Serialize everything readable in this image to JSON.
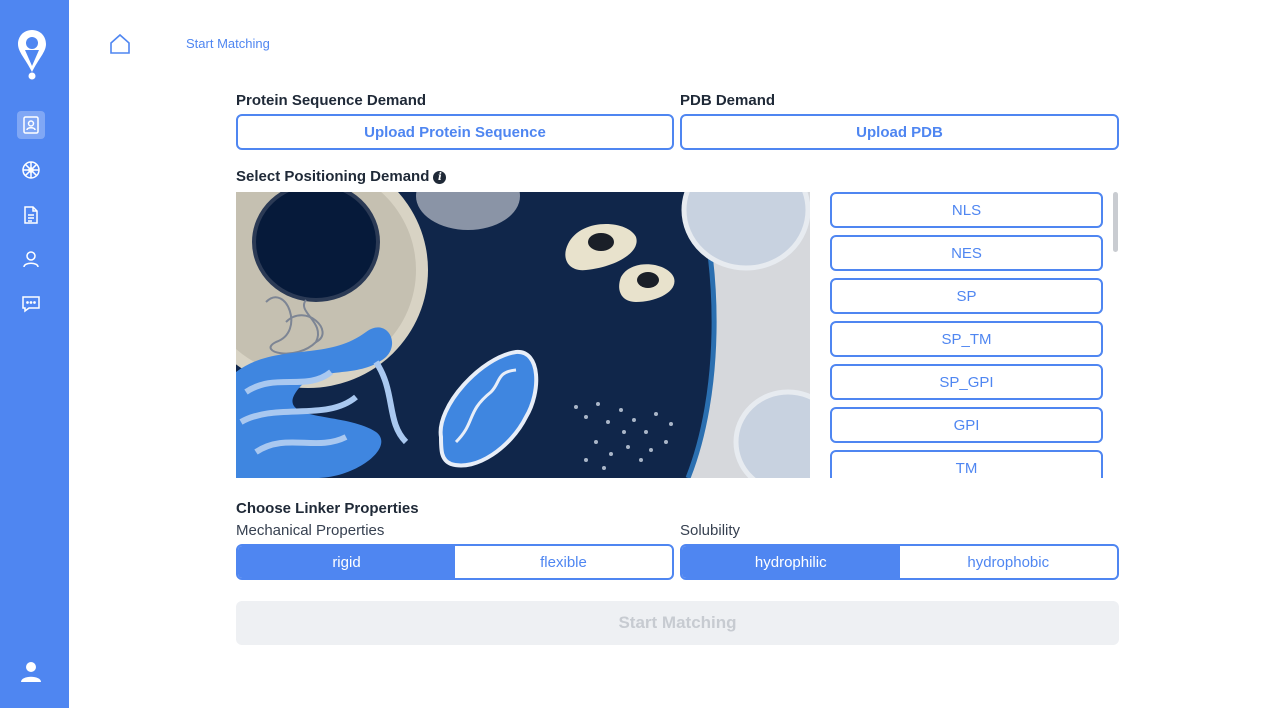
{
  "topbar": {
    "link": "Start Matching"
  },
  "sidebar": {
    "items": [
      {
        "icon": "contact-card-icon",
        "active": true
      },
      {
        "icon": "wheel-icon",
        "active": false
      },
      {
        "icon": "document-icon",
        "active": false
      },
      {
        "icon": "user-icon",
        "active": false
      },
      {
        "icon": "chat-icon",
        "active": false
      }
    ],
    "bottom_icon": "account-icon"
  },
  "protein": {
    "label": "Protein Sequence Demand",
    "button": "Upload Protein Sequence"
  },
  "pdb": {
    "label": "PDB Demand",
    "button": "Upload PDB"
  },
  "positioning": {
    "label": "Select Positioning Demand",
    "options": [
      "NLS",
      "NES",
      "SP",
      "SP_TM",
      "SP_GPI",
      "GPI",
      "TM"
    ]
  },
  "linker": {
    "label": "Choose Linker Properties",
    "mechanical": {
      "label": "Mechanical Properties",
      "options": [
        "rigid",
        "flexible"
      ],
      "selected": "rigid"
    },
    "solubility": {
      "label": "Solubility",
      "options": [
        "hydrophilic",
        "hydrophobic"
      ],
      "selected": "hydrophilic"
    }
  },
  "start_button": "Start Matching",
  "colors": {
    "accent": "#4f86f1",
    "cell_dark": "#10264a",
    "disabled_bg": "#eef0f3"
  }
}
